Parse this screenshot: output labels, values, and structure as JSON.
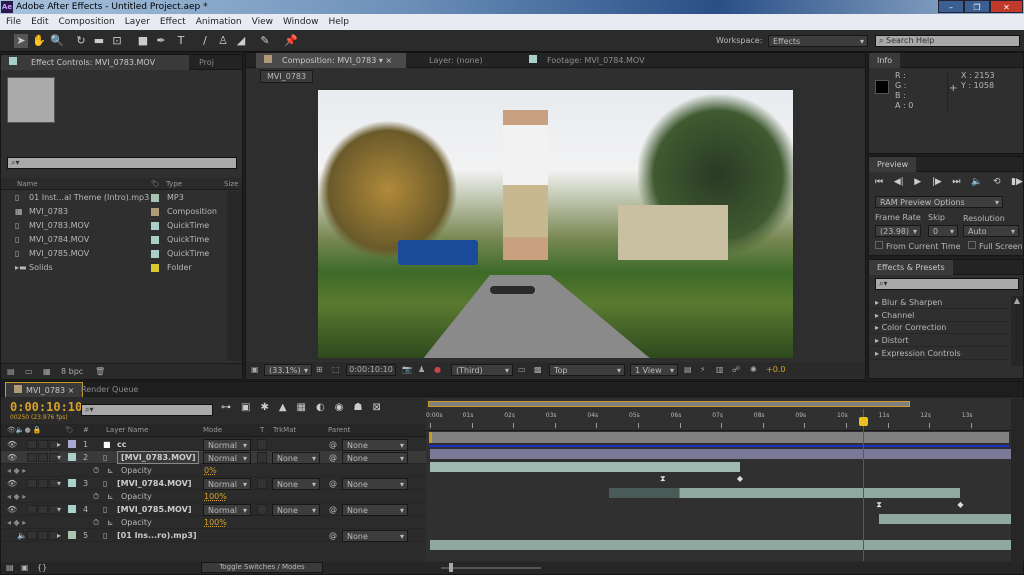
{
  "window": {
    "title": "Adobe After Effects - Untitled Project.aep *",
    "logo": "Ae",
    "controls": [
      "minimize",
      "maximize",
      "close"
    ]
  },
  "menu": [
    "File",
    "Edit",
    "Composition",
    "Layer",
    "Effect",
    "Animation",
    "View",
    "Window",
    "Help"
  ],
  "toolbar": {
    "tools": [
      "selection-icon",
      "hand-icon",
      "zoom-icon",
      "rotate-icon",
      "camera-icon",
      "pan-behind-icon",
      "rectangle-icon",
      "pen-icon",
      "type-icon",
      "brush-icon",
      "clone-stamp-icon",
      "eraser-icon",
      "roto-brush-icon",
      "puppet-pin-icon"
    ],
    "workspace_label": "Workspace:",
    "workspace_value": "Effects",
    "search_help_placeholder": "Search Help"
  },
  "project_panel": {
    "tab_effect_controls": "Effect Controls: MVI_0783.MOV",
    "tab_project": "Proj",
    "columns": {
      "name": "Name",
      "type": "Type",
      "size": "Size"
    },
    "items": [
      {
        "name": "01 Inst...al Theme (Intro).mp3",
        "type": "MP3",
        "color": "#a8c4b0",
        "icon": "audio-file-icon"
      },
      {
        "name": "MVI_0783",
        "type": "Composition",
        "color": "#b09a78",
        "icon": "composition-icon"
      },
      {
        "name": "MVI_0783.MOV",
        "type": "QuickTime",
        "color": "#a8d0c8",
        "icon": "video-file-icon"
      },
      {
        "name": "MVI_0784.MOV",
        "type": "QuickTime",
        "color": "#a8d0c8",
        "icon": "video-file-icon"
      },
      {
        "name": "MVI_0785.MOV",
        "type": "QuickTime",
        "color": "#a8d0c8",
        "icon": "video-file-icon"
      },
      {
        "name": "Solids",
        "type": "Folder",
        "color": "#d8c830",
        "icon": "folder-icon"
      }
    ],
    "bpc": "8 bpc"
  },
  "viewer": {
    "tab_composition": "Composition: MVI_0783",
    "tab_layer": "Layer: (none)",
    "tab_footage": "Footage: MVI_0784.MOV",
    "comp_button": "MVI_0783",
    "zoom": "(33.1%)",
    "timecode": "0:00:10:10",
    "resolution": "(Third)",
    "view": "Top",
    "views": "1 View",
    "exposure": "+0.0"
  },
  "info": {
    "title": "Info",
    "r": "R :",
    "g": "G :",
    "b": "B :",
    "a": "A : 0",
    "x": "X : 2153",
    "y": "Y : 1058"
  },
  "preview": {
    "title": "Preview",
    "ram_options": "RAM Preview Options",
    "frame_rate_label": "Frame Rate",
    "frame_rate": "(23.98)",
    "skip_label": "Skip",
    "skip": "0",
    "resolution_label": "Resolution",
    "resolution": "Auto",
    "from_current": "From Current Time",
    "full_screen": "Full Screen"
  },
  "effects": {
    "title": "Effects & Presets",
    "items": [
      "Blur & Sharpen",
      "Channel",
      "Color Correction",
      "Distort",
      "Expression Controls"
    ]
  },
  "timeline": {
    "tab_comp": "MVI_0783",
    "tab_render": "Render Queue",
    "timecode": "0:00:10:10",
    "frames": "00250 (23.976 fps)",
    "columns": {
      "num": "#",
      "layer_name": "Layer Name",
      "mode": "Mode",
      "t": "T",
      "trkmat": "TrkMat",
      "parent": "Parent"
    },
    "ruler": [
      "0:00s",
      "01s",
      "02s",
      "03s",
      "04s",
      "05s",
      "06s",
      "07s",
      "08s",
      "09s",
      "10s",
      "11s",
      "12s",
      "13s"
    ],
    "playhead_seconds": 10.42,
    "layers": [
      {
        "num": "1",
        "name": "cc",
        "mode": "Normal",
        "trkmat": "",
        "parent": "None",
        "color": "#a8a8d0",
        "start": 0,
        "end": 14,
        "bar": "#7a7a98"
      },
      {
        "num": "2",
        "name": "[MVI_0783.MOV]",
        "mode": "Normal",
        "trkmat": "None",
        "parent": "None",
        "color": "#a8d0c8",
        "start": 0,
        "end": 7.45,
        "bar": "#9fb8b0",
        "opacity": "0%",
        "keys": [
          5.6,
          7.45
        ]
      },
      {
        "num": "3",
        "name": "[MVI_0784.MOV]",
        "mode": "Normal",
        "trkmat": "None",
        "parent": "None",
        "color": "#a8d0c8",
        "start": 4.3,
        "end": 12.75,
        "bar": "#8fa8a0",
        "opacity": "100%",
        "keys": [
          10.8,
          12.75
        ]
      },
      {
        "num": "4",
        "name": "[MVI_0785.MOV]",
        "mode": "Normal",
        "trkmat": "None",
        "parent": "None",
        "color": "#a8d0c8",
        "start": 10.8,
        "end": 14,
        "bar": "#8fa8a0",
        "opacity": "100%"
      },
      {
        "num": "5",
        "name": "[01 Ins...ro).mp3]",
        "mode": "",
        "trkmat": "",
        "parent": "None",
        "color": "#a8c4b0",
        "start": 0,
        "end": 14,
        "bar": "#8fa8a0"
      }
    ],
    "opacity_label": "Opacity",
    "toggle": "Toggle Switches / Modes"
  }
}
